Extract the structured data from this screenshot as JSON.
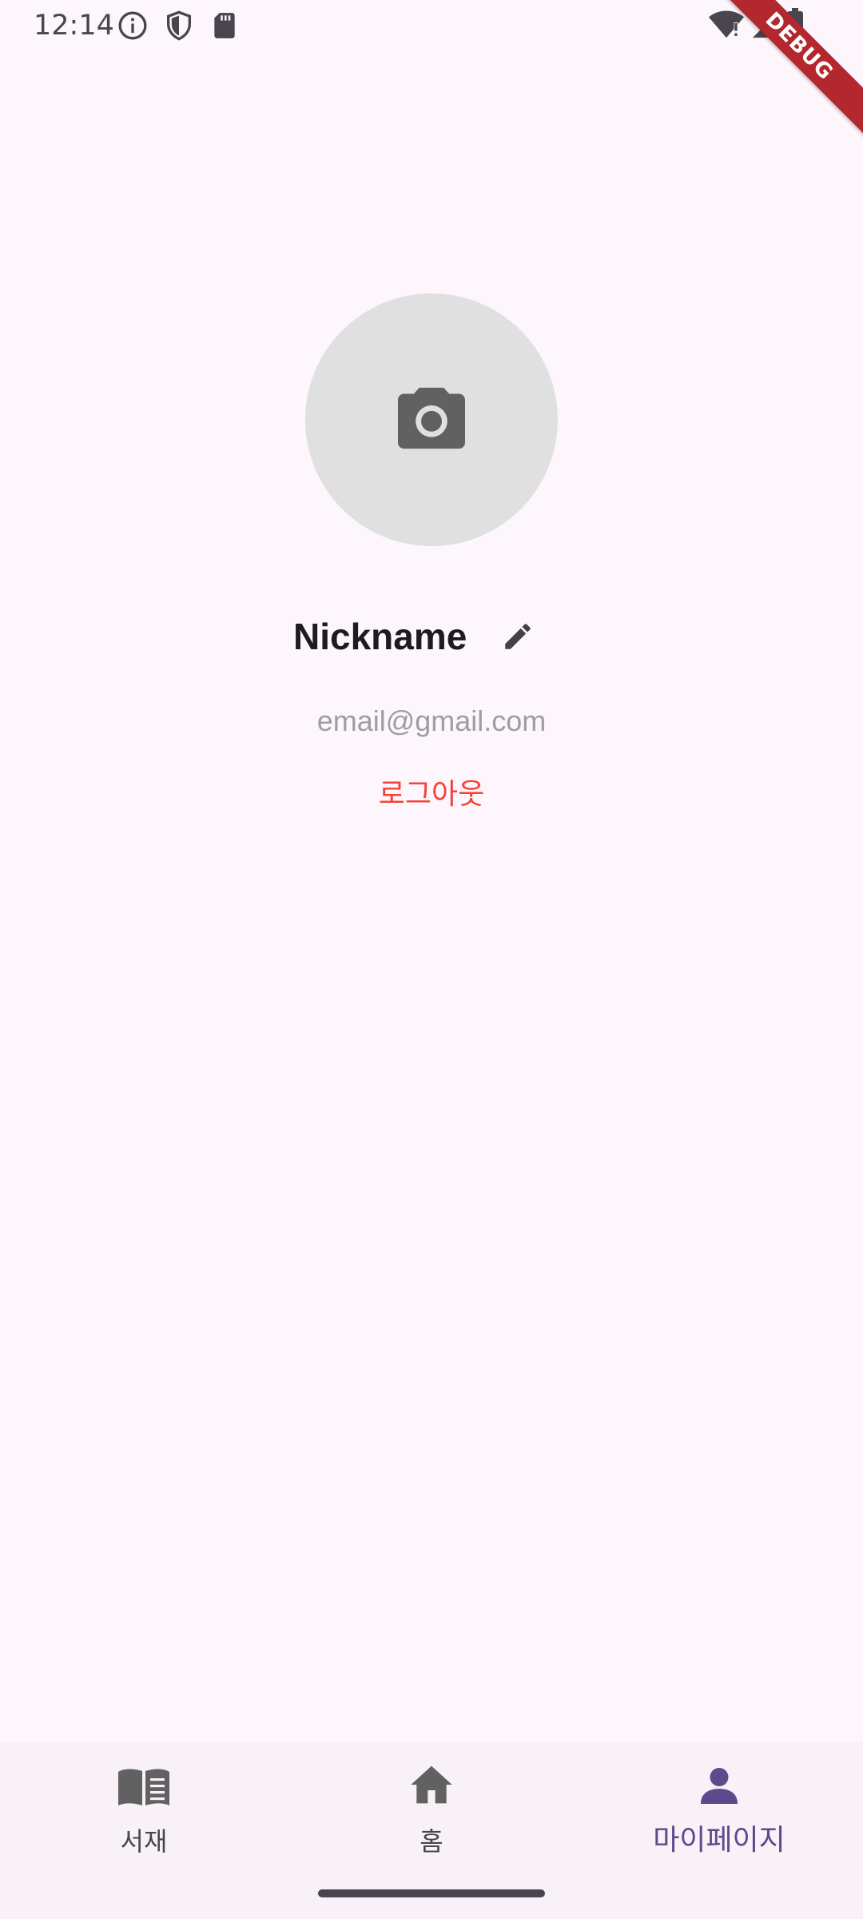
{
  "status_bar": {
    "time": "12:14",
    "icons_left": [
      "info-icon",
      "shield-icon",
      "sd-card-icon"
    ],
    "icons_right": [
      "wifi-icon",
      "signal-icon",
      "battery-icon"
    ]
  },
  "debug_banner": {
    "label": "DEBUG"
  },
  "profile": {
    "avatar_icon": "camera-icon",
    "nickname": "Nickname",
    "edit_icon": "pencil-icon",
    "email": "email@gmail.com",
    "logout_label": "로그아웃"
  },
  "bottom_nav": {
    "items": [
      {
        "label": "서재",
        "icon": "book-icon",
        "active": false
      },
      {
        "label": "홈",
        "icon": "home-icon",
        "active": false
      },
      {
        "label": "마이페이지",
        "icon": "person-icon",
        "active": true
      }
    ]
  },
  "colors": {
    "background": "#fdf7fd",
    "avatar_bg": "#e0e0e0",
    "icon_gray": "#616161",
    "logout_red": "#f44336",
    "active_nav": "#5b4a8c",
    "inactive_nav": "#49454f",
    "debug_banner": "#b3272e"
  }
}
